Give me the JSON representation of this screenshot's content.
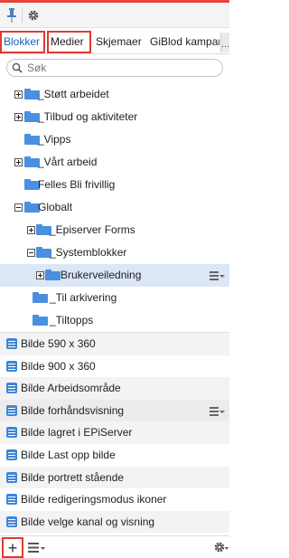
{
  "tabs": [
    {
      "label": "Blokker",
      "active": true
    },
    {
      "label": "Medier",
      "active": false
    },
    {
      "label": "Skjemaer",
      "active": false
    },
    {
      "label": "GiBlod kampan",
      "active": false
    }
  ],
  "tabs_more": "...",
  "search": {
    "placeholder": "Søk",
    "value": ""
  },
  "tree": [
    {
      "label": "_Støtt arbeidet",
      "toggle": "expand"
    },
    {
      "label": "_Tilbud og aktiviteter",
      "toggle": "expand"
    },
    {
      "label": "_Vipps",
      "toggle": "none"
    },
    {
      "label": "_Vårt arbeid",
      "toggle": "expand"
    },
    {
      "label": "Felles Bli frivillig",
      "toggle": "none"
    },
    {
      "label": "Globalt",
      "toggle": "collapse"
    },
    {
      "label": "_Episerver Forms",
      "toggle": "expand"
    },
    {
      "label": "_Systemblokker",
      "toggle": "collapse"
    },
    {
      "label": "Brukerveiledning",
      "toggle": "expand",
      "selected": true
    },
    {
      "label": "_Til arkivering",
      "toggle": "none"
    },
    {
      "label": "_Tiltopps",
      "toggle": "none"
    }
  ],
  "blocks": [
    {
      "label": "Bilde 590 x 360"
    },
    {
      "label": "Bilde 900 x 360"
    },
    {
      "label": "Bilde Arbeidsområde"
    },
    {
      "label": "Bilde forhåndsvisning",
      "menu": true
    },
    {
      "label": "Bilde lagret i EPiServer"
    },
    {
      "label": "Bilde Last opp bilde"
    },
    {
      "label": "Bilde portrett stående"
    },
    {
      "label": "Bilde redigeringsmodus ikoner"
    },
    {
      "label": "Bilde velge kanal og visning"
    }
  ],
  "bottombar": {
    "add_label": "+"
  },
  "colors": {
    "accent_blue": "#1a64b7",
    "folder_blue": "#4a8fe0",
    "highlight_red": "#e03a2f",
    "selected_row": "#dbe6f7"
  },
  "icons": [
    "pin-icon",
    "gear-icon",
    "search-icon",
    "folder-icon",
    "block-icon",
    "context-menu-icon",
    "list-icon"
  ]
}
